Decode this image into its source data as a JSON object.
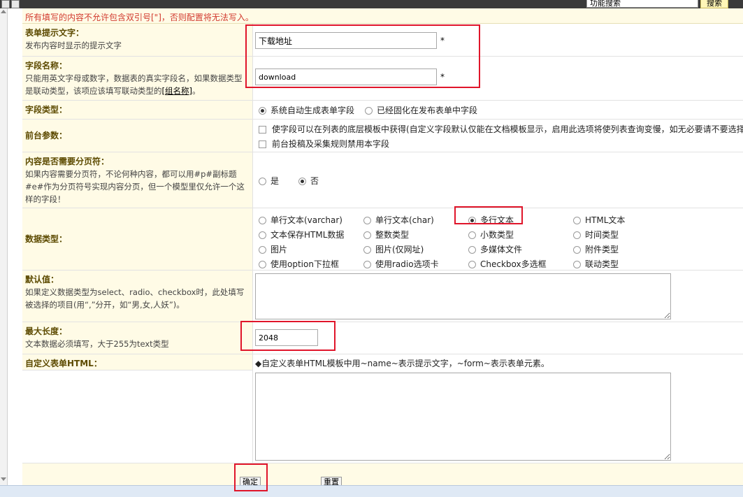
{
  "topbar": {
    "search_placeholder": "功能搜索",
    "search_button": "搜索"
  },
  "warning": "所有填写的内容不允许包含双引号[\"]，否则配置将无法写入。",
  "form": {
    "label_text": {
      "title": "表单提示文字：",
      "desc": "发布内容时显示的提示文字",
      "value": "下载地址",
      "req": "*"
    },
    "field_name": {
      "title": "字段名称：",
      "desc": "只能用英文字母或数字，数据表的真实字段名，如果数据类型是联动类型，该项应该填写联动类型的",
      "link": "[组名称]",
      "desc_end": "。",
      "value": "download",
      "req": "*"
    },
    "field_type": {
      "title": "字段类型：",
      "options": [
        {
          "label": "系统自动生成表单字段",
          "checked": true
        },
        {
          "label": "已经固化在发布表单中字段",
          "checked": false
        }
      ]
    },
    "front_params": {
      "title": "前台参数：",
      "options": [
        {
          "label": "使字段可以在列表的底层模板中获得(自定义字段默认仅能在文档模板显示，启用此选项将使列表查询变慢，如无必要请不要选择)",
          "checked": false
        },
        {
          "label": "前台投稿及采集规则禁用本字段",
          "checked": false
        }
      ]
    },
    "paging": {
      "title": "内容是否需要分页符：",
      "desc": "如果内容需要分页符，不论何种内容，都可以用#p#副标题#e#作为分页符号实现内容分页，但一个模型里仅允许一个这样的字段！",
      "options": [
        {
          "label": "是",
          "checked": false
        },
        {
          "label": "否",
          "checked": true
        }
      ]
    },
    "data_type": {
      "title": "数据类型：",
      "options": [
        {
          "label": "单行文本(varchar)",
          "checked": false
        },
        {
          "label": "单行文本(char)",
          "checked": false
        },
        {
          "label": "多行文本",
          "checked": true
        },
        {
          "label": "HTML文本",
          "checked": false
        },
        {
          "label": "文本保存HTML数据",
          "checked": false
        },
        {
          "label": "整数类型",
          "checked": false
        },
        {
          "label": "小数类型",
          "checked": false
        },
        {
          "label": "时间类型",
          "checked": false
        },
        {
          "label": "图片",
          "checked": false
        },
        {
          "label": "图片(仅网址)",
          "checked": false
        },
        {
          "label": "多媒体文件",
          "checked": false
        },
        {
          "label": "附件类型",
          "checked": false
        },
        {
          "label": "使用option下拉框",
          "checked": false
        },
        {
          "label": "使用radio选项卡",
          "checked": false
        },
        {
          "label": "Checkbox多选框",
          "checked": false
        },
        {
          "label": "联动类型",
          "checked": false
        }
      ]
    },
    "default_value": {
      "title": "默认值：",
      "desc": "如果定义数据类型为select、radio、checkbox时，此处填写被选择的项目(用“,”分开，如“男,女,人妖”)。",
      "value": ""
    },
    "max_length": {
      "title": "最大长度：",
      "desc": "文本数据必须填写，大于255为text类型",
      "value": "2048"
    },
    "custom_html": {
      "title": "自定义表单HTML：",
      "hint": "◆自定义表单HTML模板中用~name~表示提示文字，~form~表示表单元素。",
      "value": ""
    }
  },
  "buttons": {
    "submit": "确定",
    "reset": "重置"
  }
}
